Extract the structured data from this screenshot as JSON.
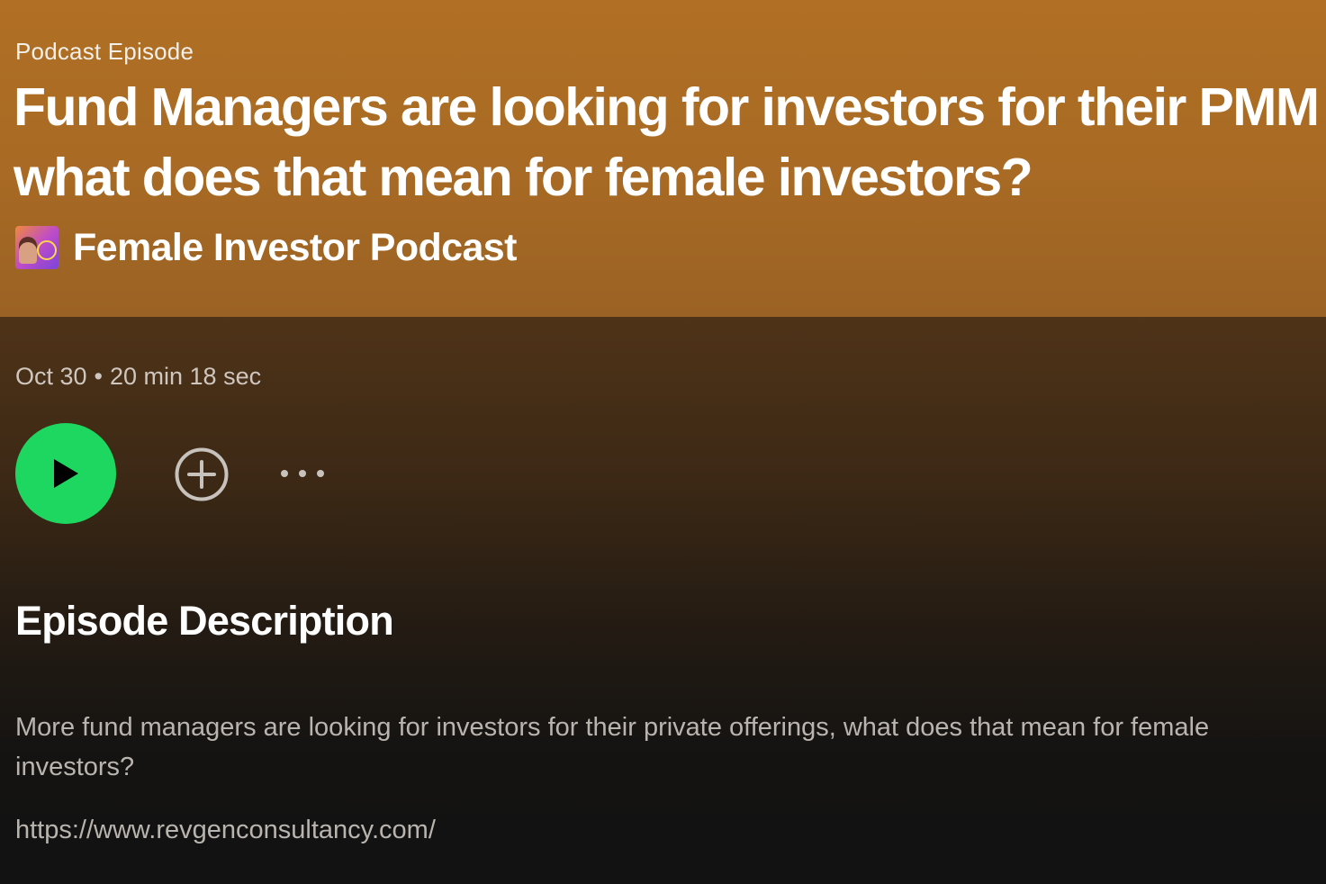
{
  "episode": {
    "eyebrow": "Podcast Episode",
    "title": "Fund Managers are looking for investors for their PMM what does that mean for female investors?",
    "show_name": "Female Investor Podcast",
    "date": "Oct 30",
    "separator": "•",
    "duration": "20 min 18 sec"
  },
  "actions": {
    "play_icon": "play-icon",
    "add_icon": "plus-circle-icon",
    "more_icon": "more-horizontal-icon"
  },
  "description": {
    "heading": "Episode Description",
    "text": "More fund managers are looking for investors for their private offerings, what does that mean for female investors?",
    "link": "https://www.revgenconsultancy.com/"
  },
  "colors": {
    "hero": "#b06f24",
    "play_button": "#1ed760",
    "background": "#121212"
  }
}
